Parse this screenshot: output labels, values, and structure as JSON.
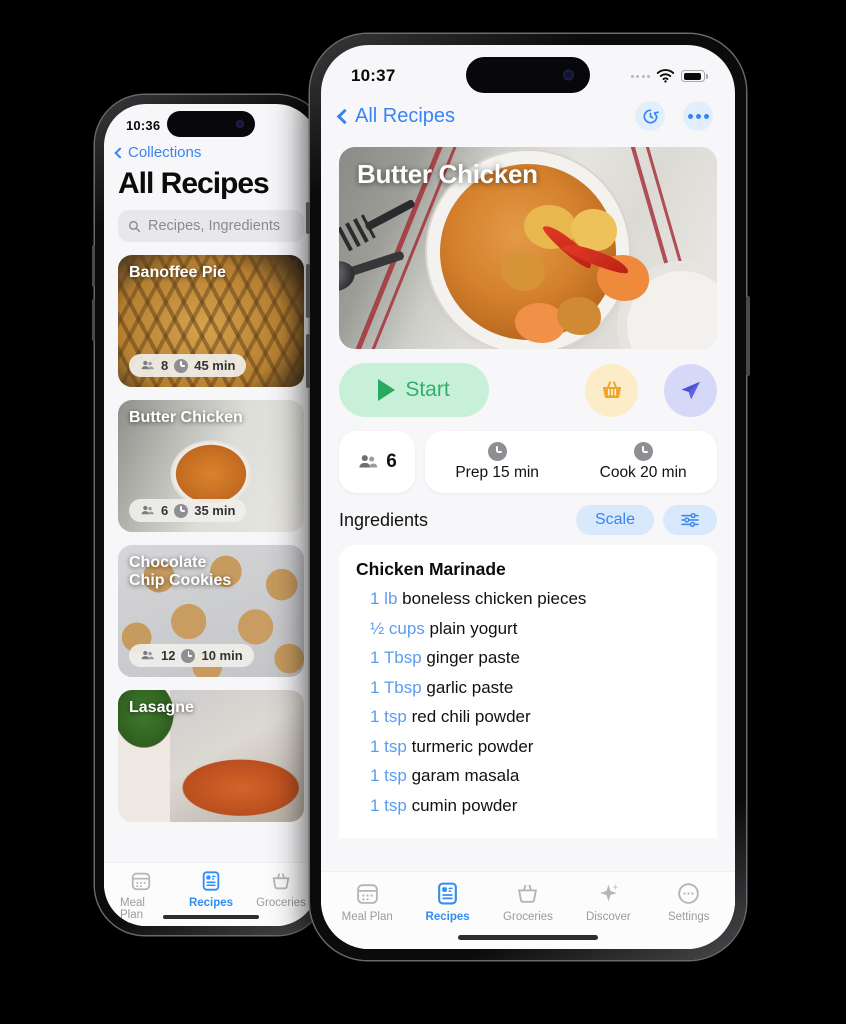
{
  "back_phone": {
    "status_bar": {
      "time": "10:36"
    },
    "nav": {
      "back_label": "Collections"
    },
    "page_title": "All Recipes",
    "search": {
      "placeholder": "Recipes, Ingredients"
    },
    "recipes": [
      {
        "title": "Banoffee Pie",
        "servings": "8",
        "time": "45 min",
        "image": "banoffee-pie-photo"
      },
      {
        "title": "Butter Chicken",
        "servings": "6",
        "time": "35 min",
        "image": "butter-chicken-photo"
      },
      {
        "title": "Chocolate\nChip Cookies",
        "servings": "12",
        "time": "10 min",
        "image": "chocolate-chip-cookies-photo"
      },
      {
        "title": "Lasagne",
        "servings": "",
        "time": "",
        "image": "lasagne-photo"
      }
    ],
    "tabs": [
      {
        "label": "Meal Plan",
        "icon": "meal-plan-icon",
        "active": false
      },
      {
        "label": "Recipes",
        "icon": "recipes-icon",
        "active": true
      },
      {
        "label": "Groceries",
        "icon": "groceries-icon",
        "active": false
      }
    ]
  },
  "front_phone": {
    "status_bar": {
      "time": "10:37",
      "wifi": "wifi-icon",
      "battery": "battery-icon",
      "signal": "signal-dots-icon"
    },
    "nav": {
      "back_label": "All Recipes",
      "timer_icon": "timer-icon",
      "more_icon": "more-ellipsis-icon"
    },
    "hero": {
      "title": "Butter Chicken",
      "image": "butter-chicken-hero-photo"
    },
    "actions": {
      "start_label": "Start",
      "start_icon": "play-icon",
      "basket_icon": "basket-icon",
      "share_icon": "paper-plane-icon"
    },
    "meta": {
      "servings_icon": "people-icon",
      "servings": "6",
      "prep": {
        "icon": "clock-icon",
        "label": "Prep 15 min"
      },
      "cook": {
        "icon": "clock-icon",
        "label": "Cook 20 min"
      }
    },
    "ingredients_header": {
      "title": "Ingredients",
      "scale_label": "Scale",
      "filter_icon": "sliders-icon"
    },
    "ingredients": {
      "group_title": "Chicken Marinade",
      "items": [
        {
          "qty": "1 lb",
          "name": "boneless chicken pieces"
        },
        {
          "qty": "½ cups",
          "name": "plain yogurt"
        },
        {
          "qty": "1 Tbsp",
          "name": "ginger paste"
        },
        {
          "qty": "1 Tbsp",
          "name": "garlic paste"
        },
        {
          "qty": "1 tsp",
          "name": "red chili powder"
        },
        {
          "qty": "1 tsp",
          "name": "turmeric powder"
        },
        {
          "qty": "1 tsp",
          "name": "garam masala"
        },
        {
          "qty": "1 tsp",
          "name": "cumin powder"
        }
      ]
    },
    "tabs": [
      {
        "label": "Meal Plan",
        "icon": "meal-plan-icon",
        "active": false
      },
      {
        "label": "Recipes",
        "icon": "recipes-icon",
        "active": true
      },
      {
        "label": "Groceries",
        "icon": "groceries-icon",
        "active": false
      },
      {
        "label": "Discover",
        "icon": "sparkle-icon",
        "active": false
      },
      {
        "label": "Settings",
        "icon": "settings-icon",
        "active": false
      }
    ]
  },
  "colors": {
    "accent_blue": "#3a84f2",
    "start_green_bg": "#c8f0d8",
    "start_green_fg": "#2fb06a",
    "basket_bg": "#fcecc8",
    "basket_fg": "#f0a62a",
    "share_bg": "#d6d8f8",
    "share_fg": "#4a52d6",
    "pill_blue_bg": "#d7e9fb",
    "screen_bg": "#f7f7f9",
    "qty_blue": "#5b9cf0"
  }
}
